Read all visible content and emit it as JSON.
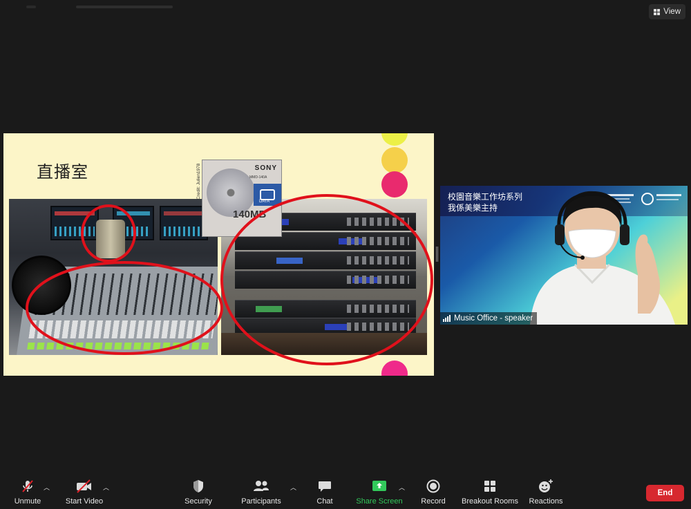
{
  "topbar": {
    "view_label": "View"
  },
  "slide": {
    "title": "直播室",
    "photo_credit": "Credit: Julien1978",
    "md_brand": "SONY",
    "md_model": "MMD-140A",
    "md_size": "140MB",
    "md_label": "DATA"
  },
  "speaker": {
    "title_line1": "校園音樂工作坊系列",
    "title_line2": "我係美樂主持",
    "name": "Music Office - speaker"
  },
  "toolbar": {
    "unmute": "Unmute",
    "start_video": "Start Video",
    "security": "Security",
    "participants": "Participants",
    "chat": "Chat",
    "share_screen": "Share Screen",
    "record": "Record",
    "breakout_rooms": "Breakout Rooms",
    "reactions": "Reactions",
    "end": "End"
  },
  "colors": {
    "share_screen_green": "#32c95b",
    "end_red": "#d7282f",
    "annotation_red": "#e0111b",
    "slide_bg": "#fcf5c8"
  }
}
